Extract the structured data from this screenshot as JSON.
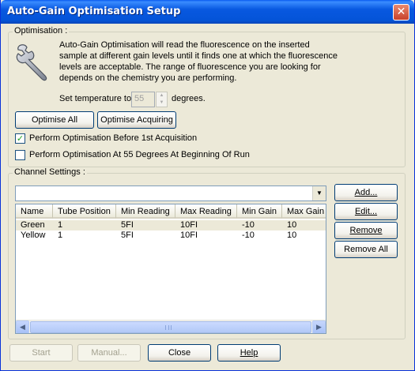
{
  "window": {
    "title": "Auto-Gain Optimisation Setup",
    "close_glyph": "✕"
  },
  "optimisation": {
    "group_label": "Optimisation :",
    "icon": "wrench-icon",
    "description": "Auto-Gain Optimisation will read the fluorescence on the inserted sample at different gain levels until it finds one at which the fluorescence levels are acceptable. The range of fluorescence you are looking for depends on the chemistry you are performing.",
    "temp_label": "Set temperature to",
    "temp_value": "55",
    "temp_unit": "degrees.",
    "optimise_all_label": "Optimise All",
    "optimise_acquiring_label": "Optimise Acquiring",
    "before_acq_label": "Perform Optimisation Before 1st Acquisition",
    "before_acq_checked": true,
    "at55_label": "Perform Optimisation At 55 Degrees At Beginning Of Run",
    "at55_checked": false
  },
  "channel_settings": {
    "group_label": "Channel Settings :",
    "combo_value": "",
    "columns": [
      "Name",
      "Tube Position",
      "Min Reading",
      "Max Reading",
      "Min Gain",
      "Max Gain"
    ],
    "rows": [
      [
        "Green",
        "1",
        "5FI",
        "10FI",
        "-10",
        "10"
      ],
      [
        "Yellow",
        "1",
        "5FI",
        "10FI",
        "-10",
        "10"
      ]
    ],
    "add_label": "Add...",
    "edit_label": "Edit...",
    "remove_label": "Remove",
    "remove_all_label": "Remove All"
  },
  "footer": {
    "start_label": "Start",
    "manual_label": "Manual...",
    "close_label": "Close",
    "help_label": "Help"
  }
}
